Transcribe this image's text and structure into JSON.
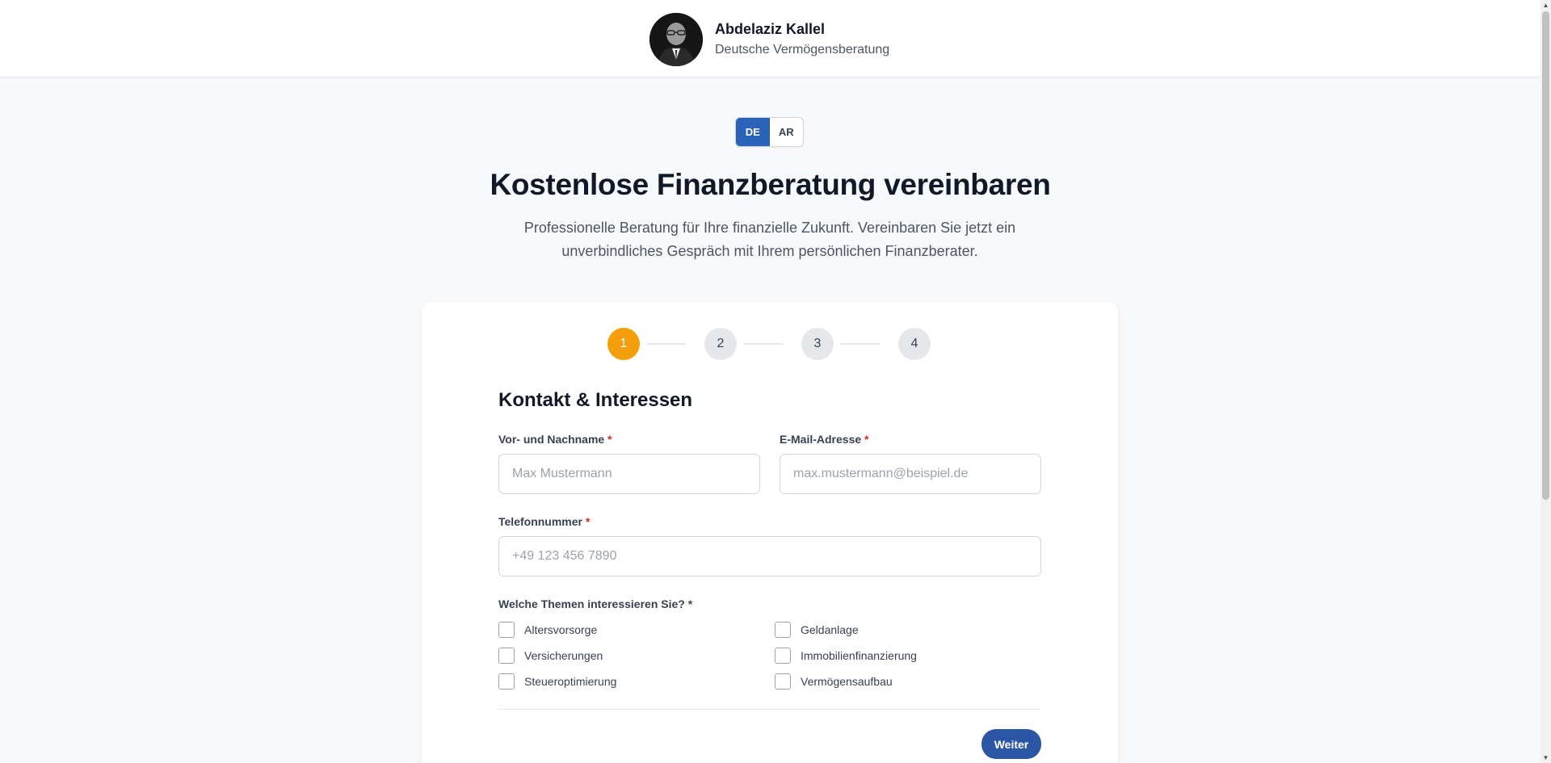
{
  "header": {
    "name": "Abdelaziz Kallel",
    "company": "Deutsche Vermögensberatung"
  },
  "language_switch": {
    "options": [
      "DE",
      "AR"
    ],
    "active": "DE"
  },
  "hero": {
    "title": "Kostenlose Finanzberatung vereinbaren",
    "subtitle": "Professionelle Beratung für Ihre finanzielle Zukunft. Vereinbaren Sie jetzt ein unverbindliches Gespräch mit Ihrem persönlichen Finanzberater."
  },
  "stepper": {
    "steps": [
      "1",
      "2",
      "3",
      "4"
    ],
    "current": 1
  },
  "form": {
    "section_title": "Kontakt & Interessen",
    "name": {
      "label": "Vor- und Nachname",
      "required_mark": "*",
      "placeholder": "Max Mustermann",
      "value": ""
    },
    "email": {
      "label": "E-Mail-Adresse",
      "required_mark": "*",
      "placeholder": "max.mustermann@beispiel.de",
      "value": ""
    },
    "phone": {
      "label": "Telefonnummer",
      "required_mark": "*",
      "placeholder": "+49 123 456 7890",
      "value": ""
    },
    "topics": {
      "label": "Welche Themen interessieren Sie? *",
      "options": [
        {
          "label": "Altersvorsorge",
          "checked": false
        },
        {
          "label": "Geldanlage",
          "checked": false
        },
        {
          "label": "Versicherungen",
          "checked": false
        },
        {
          "label": "Immobilienfinanzierung",
          "checked": false
        },
        {
          "label": "Steueroptimierung",
          "checked": false
        },
        {
          "label": "Vermögensaufbau",
          "checked": false
        }
      ]
    },
    "next_label": "Weiter"
  },
  "colors": {
    "accent_blue": "#2b56a5",
    "active_step": "#f59e0b",
    "required": "#dc2626"
  }
}
